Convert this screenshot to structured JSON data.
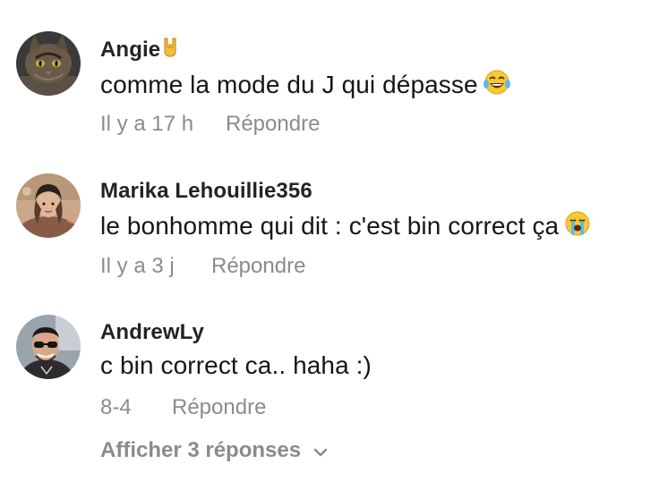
{
  "comments": [
    {
      "username": "Angie",
      "username_emoji": "🤘",
      "text": "comme la mode du J qui dépasse",
      "text_emoji": "😂",
      "time": "Il y a 17 h",
      "reply_label": "Répondre"
    },
    {
      "username": "Marika Lehouillie356",
      "text": "le bonhomme qui dit : c'est bin correct ça",
      "text_emoji": "😭",
      "time": "Il y a 3 j",
      "reply_label": "Répondre"
    },
    {
      "username": "AndrewLy",
      "text": "c bin correct ca.. haha :)",
      "time": "8-4",
      "reply_label": "Répondre"
    }
  ],
  "show_replies_label": "Afficher 3 réponses",
  "icons": {
    "username_emoji": "rock-hand-icon",
    "laugh_emoji": "tears-of-joy-icon",
    "cry_emoji": "loudly-crying-icon",
    "expand": "chevron-down-icon"
  },
  "colors": {
    "username": "#232323",
    "text": "#161616",
    "meta": "#8a8b91"
  }
}
